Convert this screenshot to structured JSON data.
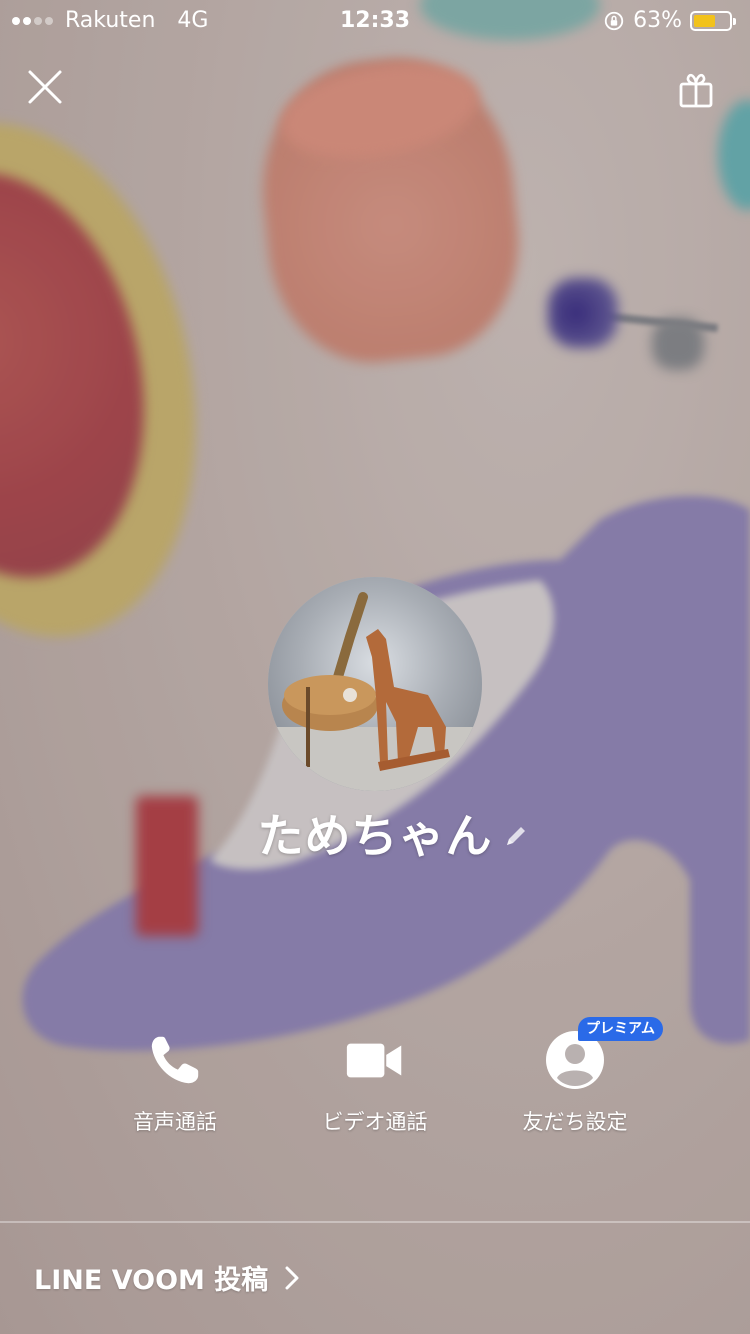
{
  "status_bar": {
    "carrier": "Rakuten",
    "network": "4G",
    "time": "12:33",
    "battery_percent": "63%",
    "battery_level": 0.63,
    "battery_color": "#f2c21b"
  },
  "header": {
    "close_icon": "close-icon",
    "gift_icon": "gift-icon"
  },
  "profile": {
    "name": "ためちゃん",
    "edit_icon": "pencil-icon"
  },
  "actions": [
    {
      "label": "音声通話",
      "icon": "phone-icon"
    },
    {
      "label": "ビデオ通話",
      "icon": "video-camera-icon"
    },
    {
      "label": "友だち設定",
      "icon": "person-icon",
      "badge": "プレミアム"
    }
  ],
  "colors": {
    "premium_badge": "#2a6ae8"
  },
  "footer": {
    "voom_link": "LINE VOOM 投稿"
  }
}
